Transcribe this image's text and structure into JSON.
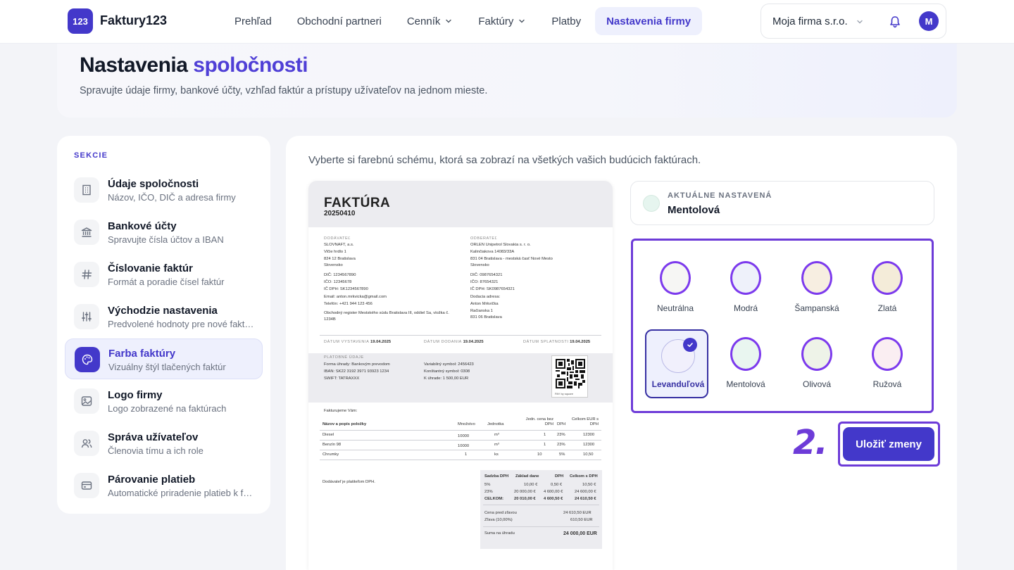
{
  "app": {
    "logo_badge": "123",
    "name": "Faktury123"
  },
  "nav": {
    "items": [
      {
        "label": "Prehľad"
      },
      {
        "label": "Obchodní partneri"
      },
      {
        "label": "Cenník"
      },
      {
        "label": "Faktúry"
      },
      {
        "label": "Platby"
      },
      {
        "label": "Nastavenia firmy"
      }
    ]
  },
  "account": {
    "company": "Moja firma s.r.o.",
    "avatar_initial": "M"
  },
  "header": {
    "title_main": "Nastavenia",
    "title_accent": "spoločnosti",
    "subtitle": "Spravujte údaje firmy, bankové účty, vzhľad faktúr a prístupy užívateľov na jednom mieste."
  },
  "sidebar": {
    "section_label": "SEKCIE",
    "items": [
      {
        "title": "Údaje spoločnosti",
        "desc": "Názov, IČO, DIČ a adresa firmy",
        "icon": "building-icon"
      },
      {
        "title": "Bankové účty",
        "desc": "Spravujte čísla účtov a IBAN",
        "icon": "bank-icon"
      },
      {
        "title": "Číslovanie faktúr",
        "desc": "Formát a poradie čísel faktúr",
        "icon": "hash-icon"
      },
      {
        "title": "Východzie nastavenia",
        "desc": "Predvolené hodnoty pre nové faktúry",
        "icon": "sliders-icon"
      },
      {
        "title": "Farba faktúry",
        "desc": "Vizuálny štýl tlačených faktúr",
        "icon": "palette-icon"
      },
      {
        "title": "Logo firmy",
        "desc": "Logo zobrazené na faktúrach",
        "icon": "image-icon"
      },
      {
        "title": "Správa užívateľov",
        "desc": "Členovia tímu a ich role",
        "icon": "users-icon"
      },
      {
        "title": "Párovanie platieb",
        "desc": "Automatické priradenie platieb k faktúram",
        "icon": "card-icon"
      }
    ]
  },
  "main": {
    "intro": "Vyberte si farebnú schému, ktorá sa zobrazí na všetkých vašich budúcich faktúrach.",
    "current_label": "AKTUÁLNE NASTAVENÁ",
    "current_value": "Mentolová",
    "step_number": "2.",
    "save_label": "Uložiť zmeny"
  },
  "swatches": [
    {
      "label": "Neutrálna",
      "color": "#f6f6f4"
    },
    {
      "label": "Modrá",
      "color": "#eef1fa"
    },
    {
      "label": "Šampanská",
      "color": "#f7eee1"
    },
    {
      "label": "Zlatá",
      "color": "#f4ecd9"
    },
    {
      "label": "Levanduľová",
      "color": "#f1f0fc",
      "selected": true
    },
    {
      "label": "Mentolová",
      "color": "#e9f6f0"
    },
    {
      "label": "Olivová",
      "color": "#eef3e8"
    },
    {
      "label": "Ružová",
      "color": "#faeef2"
    }
  ],
  "invoice": {
    "title": "FAKTÚRA",
    "number": "20250410",
    "supplier_label": "DODÁVATEĽ",
    "supplier": "SLOVNAFT, a.s.\nVlčie hrdlo 1\n824 12 Bratislava\nSlovensko",
    "supplier_ids": "DIČ: 1234567890\nIČO: 12345678\nIČ DPH: SK1234567890",
    "supplier_contact": "Email: anton.mrkvicka@gmail.com\nTelefón: +421 944 123 456",
    "supplier_register": "Obchodný register Mestského súdu Bratislava III, oddiel Sa, vložka č.\n1234B",
    "customer_label": "ODBERATEĽ",
    "customer": "ORLEN Unipetrol Slovakia s. r. o.\nKalinčiakova 14083/33A\n831 04 Bratislava - mestská časť Nové Mesto\nSlovensko",
    "customer_ids": "DIČ: 0987654321\nIČO: 87654321\nIČ DPH: SK0987654321",
    "delivery": "Dodacia adresa:\nAnton Mrkvička\nRačianska 1\n831 06 Bratislava",
    "issue_label": "DÁTUM VYSTAVENIA",
    "issue_date": "19.04.2025",
    "delivery_label": "DÁTUM DODANIA",
    "delivery_date": "19.04.2025",
    "due_label": "DÁTUM SPLATNOSTI",
    "due_date": "19.04.2025",
    "payment_label": "PLATOBNÉ ÚDAJE",
    "payment_left": "Forma úhrady: Bankovým prevodom\nIBAN: SK22 3192 3971 93923 1234\nSWIFT: TATRAXXX",
    "payment_right": "Variabilný symbol: 2456423\nKonštantný symbol: 0308\nK úhrade: 1 500,00 EUR",
    "qr_tag": "PAY by square",
    "invoicing_text": "Fakturujeme Vám:",
    "columns": [
      "Názov a popis položky",
      "Množstvo",
      "Jednotka",
      "Jedn. cena bez DPH",
      "DPH",
      "Celkom EUR s DPH"
    ],
    "rows": [
      [
        "Diesel",
        "10000",
        "m³",
        "1",
        "23%",
        "12300"
      ],
      [
        "Benzín 98",
        "10000",
        "m³",
        "1",
        "23%",
        "12300"
      ],
      [
        "Chrumky",
        "1",
        "ks",
        "10",
        "5%",
        "10,50"
      ]
    ],
    "vat_note": "Dodávateľ je platiteľom DPH.",
    "summary_head": [
      "Sadzba DPH",
      "Základ dane",
      "DPH",
      "Celkom s DPH"
    ],
    "summary_rows": [
      [
        "5%",
        "10,00 €",
        "0,50 €",
        "10,50 €"
      ],
      [
        "23%",
        "20 000,00 €",
        "4 600,00 €",
        "24 600,00 €"
      ],
      [
        "CELKOM:",
        "20 010,00 €",
        "4 600,50 €",
        "24 610,50 €"
      ]
    ],
    "price_before": "Cena pred zľavou",
    "price_before_val": "24 610,50 EUR",
    "discount": "Zľava (10,00%)",
    "discount_val": "610,50 EUR",
    "total_label": "Suma na úhradu",
    "total_val": "24 000,00 EUR"
  }
}
